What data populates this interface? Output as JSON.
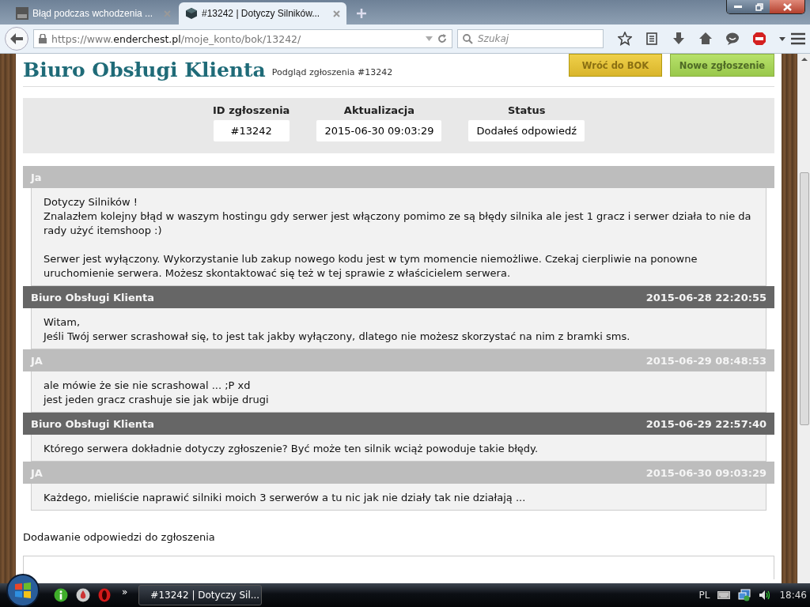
{
  "browser": {
    "tabs": [
      {
        "title": "Błąd podczas wchodzenia ...",
        "selected": false
      },
      {
        "title": "#13242 | Dotyczy Silników...",
        "selected": true
      }
    ],
    "url": {
      "prefix": "https://www.",
      "domain": "enderchest.pl",
      "path": "/moje_konto/bok/13242/"
    },
    "search": {
      "placeholder": "Szukaj"
    }
  },
  "page": {
    "title": "Biuro Obsługi Klienta",
    "subtitle": "Podgląd zgłoszenia #13242",
    "buttons": [
      {
        "label": "Wróć do BOK",
        "kind": "back"
      },
      {
        "label": "Nowe zgłoszenie",
        "kind": "new"
      }
    ],
    "info": [
      {
        "label": "ID zgłoszenia",
        "value": "#13242"
      },
      {
        "label": "Aktualizacja",
        "value": "2015-06-30 09:03:29"
      },
      {
        "label": "Status",
        "value": "Dodałeś odpowiedź"
      }
    ],
    "messages": [
      {
        "kind": "user",
        "author": "Ja",
        "paragraphs": [
          "Dotyczy Silników !\nZnalazłem kolejny błąd w waszym hostingu gdy serwer jest włączony pomimo ze są błędy silnika ale jest 1 gracz i serwer działa to nie da rady użyć itemshoop :)",
          "Serwer jest wyłączony. Wykorzystanie lub zakup nowego kodu jest w tym momencie niemożliwe. Czekaj cierpliwie na ponowne uruchomienie serwera. Możesz skontaktować się też w tej sprawie z właścicielem serwera."
        ]
      },
      {
        "kind": "staff",
        "author": "Biuro Obsługi Klienta",
        "date": "2015-06-28 22:20:55",
        "paragraphs": [
          "Witam,\nJeśli Twój serwer scrashował się, to jest tak jakby wyłączony, dlatego nie możesz skorzystać na nim z bramki sms."
        ]
      },
      {
        "kind": "user",
        "author": "JA",
        "date": "2015-06-29 08:48:53",
        "paragraphs": [
          "ale mówie że sie nie scrashowal ... ;P xd\njest jeden gracz crashuje sie jak wbije drugi"
        ]
      },
      {
        "kind": "staff",
        "author": "Biuro Obsługi Klienta",
        "date": "2015-06-29 22:57:40",
        "paragraphs": [
          "Którego serwera dokładnie dotyczy zgłoszenie? Być może ten silnik wciąż powoduje takie błędy."
        ]
      },
      {
        "kind": "user",
        "author": "JA",
        "date": "2015-06-30 09:03:29",
        "paragraphs": [
          "Każdego, mieliście naprawić silniki moich 3 serwerów a tu nic jak nie działy tak nie działają ..."
        ]
      }
    ],
    "reply_heading": "Dodawanie odpowiedzi do zgłoszenia"
  },
  "taskbar": {
    "more": "»",
    "tasks": [
      {
        "title": "#13242 | Dotyczy Sil...",
        "selected": true
      }
    ],
    "language": "PL",
    "time": "18:46"
  }
}
